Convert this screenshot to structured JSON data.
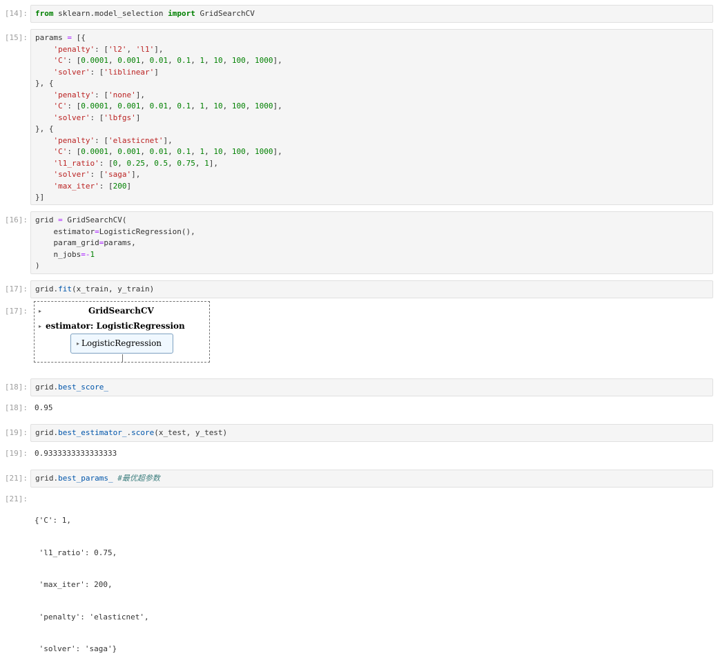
{
  "cells": [
    {
      "prompt": "[14]:"
    },
    {
      "prompt": "[15]:"
    },
    {
      "prompt": "[16]:"
    },
    {
      "prompt": "[17]:"
    },
    {
      "prompt": "[17]:"
    },
    {
      "prompt": "[18]:",
      "output": "0.95"
    },
    {
      "prompt": "[19]:",
      "output": "0.9333333333333333"
    },
    {
      "prompt": "[21]:"
    }
  ],
  "code": {
    "c14": {
      "kw_from": "from",
      "module": " sklearn.model_selection ",
      "kw_import": "import",
      "name": " GridSearchCV"
    },
    "c18": {
      "obj": "grid.",
      "attr": "best_score_"
    },
    "c19": {
      "obj": "grid.",
      "attr1": "best_estimator_",
      "dot": ".",
      "attr2": "score",
      "args": "(x_test, y_test)"
    },
    "c21": {
      "obj": "grid.",
      "attr": "best_params_",
      "comment": "#最优超参数"
    }
  },
  "estimator_widget": {
    "title": "GridSearchCV",
    "estimator_label": "estimator: LogisticRegression",
    "inner_label": "LogisticRegression",
    "toggle_glyph": "▸"
  },
  "outputs": {
    "best_params_lines": [
      "{'C': 1,",
      " 'l1_ratio': 0.75,",
      " 'max_iter': 200,",
      " 'penalty': 'elasticnet',",
      " 'solver': 'saga'}"
    ]
  }
}
